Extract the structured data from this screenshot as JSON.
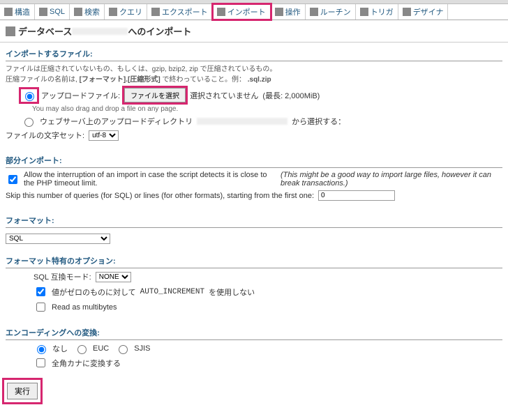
{
  "tabs": {
    "t0": "構造",
    "t1": "SQL",
    "t2": "検索",
    "t3": "クエリ",
    "t4": "エクスポート",
    "t5": "インポート",
    "t6": "操作",
    "t7": "ルーチン",
    "t8": "トリガ",
    "t9": "デザイナ"
  },
  "page_title_prefix": "データベース",
  "page_title_suffix": "へのインポート",
  "file_section": {
    "header": "インポートするファイル:",
    "help1": "ファイルは圧縮されていないもの、もしくは、gzip, bzip2, zip で圧縮されているもの。",
    "help2_prefix": "圧縮ファイルの名前は,",
    "help2_bold": "[フォーマット].[圧縮形式]",
    "help2_suffix": "で終わっていること。例：",
    "help2_example": ".sql.zip",
    "upload_label": "アップロードファイル:",
    "file_button": "ファイルを選択",
    "no_file": "選択されていません",
    "max_size": "(最長: 2,000MiB)",
    "drag_hint": "You may also drag and drop a file on any page.",
    "web_dir_label": "ウェブサーバ上のアップロードディレクトリ",
    "web_dir_suffix": "から選択する：",
    "charset_label": "ファイルの文字セット:",
    "charset_value": "utf-8"
  },
  "partial": {
    "header": "部分インポート:",
    "checkbox_en": "Allow the interruption of an import in case the script detects it is close to the PHP timeout limit.",
    "checkbox_note": "(This might be a good way to import large files, however it can break transactions.)",
    "skip_label": "Skip this number of queries (for SQL) or lines (for other formats), starting from the first one:",
    "skip_value": "0"
  },
  "format": {
    "header": "フォーマット:",
    "value": "SQL"
  },
  "format_opts": {
    "header": "フォーマット特有のオプション:",
    "compat_label": "SQL 互換モード:",
    "compat_value": "NONE",
    "auto_inc_prefix": "値がゼロのものに対して",
    "auto_inc_code": "AUTO_INCREMENT",
    "auto_inc_suffix": "を使用しない",
    "multibytes": "Read as multibytes"
  },
  "encoding": {
    "header": "エンコーディングへの変換:",
    "opt_none": "なし",
    "opt_euc": "EUC",
    "opt_sjis": "SJIS",
    "zenkaku": "全角カナに変換する"
  },
  "go_button": "実行"
}
